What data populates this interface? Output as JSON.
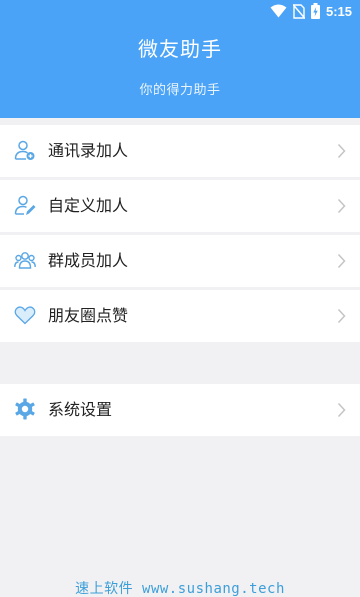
{
  "status_bar": {
    "time": "5:15",
    "icons": [
      "wifi-icon",
      "no-sim-icon",
      "battery-charging-icon"
    ]
  },
  "header": {
    "title": "微友助手",
    "subtitle": "你的得力助手",
    "background_color": "#4aa3f6"
  },
  "menu": {
    "items": [
      {
        "label": "通讯录加人",
        "icon": "contacts-add-person-icon"
      },
      {
        "label": "自定义加人",
        "icon": "custom-add-person-icon"
      },
      {
        "label": "群成员加人",
        "icon": "group-members-icon"
      },
      {
        "label": "朋友圈点赞",
        "icon": "heart-icon"
      }
    ],
    "settings": {
      "label": "系统设置",
      "icon": "gear-icon"
    }
  },
  "watermark": "速上软件 www.sushang.tech",
  "colors": {
    "accent": "#4aa3f6",
    "icon_blue": "#5aa7e6",
    "chevron": "#c4c4c4",
    "page_background": "#f1f1f3"
  }
}
